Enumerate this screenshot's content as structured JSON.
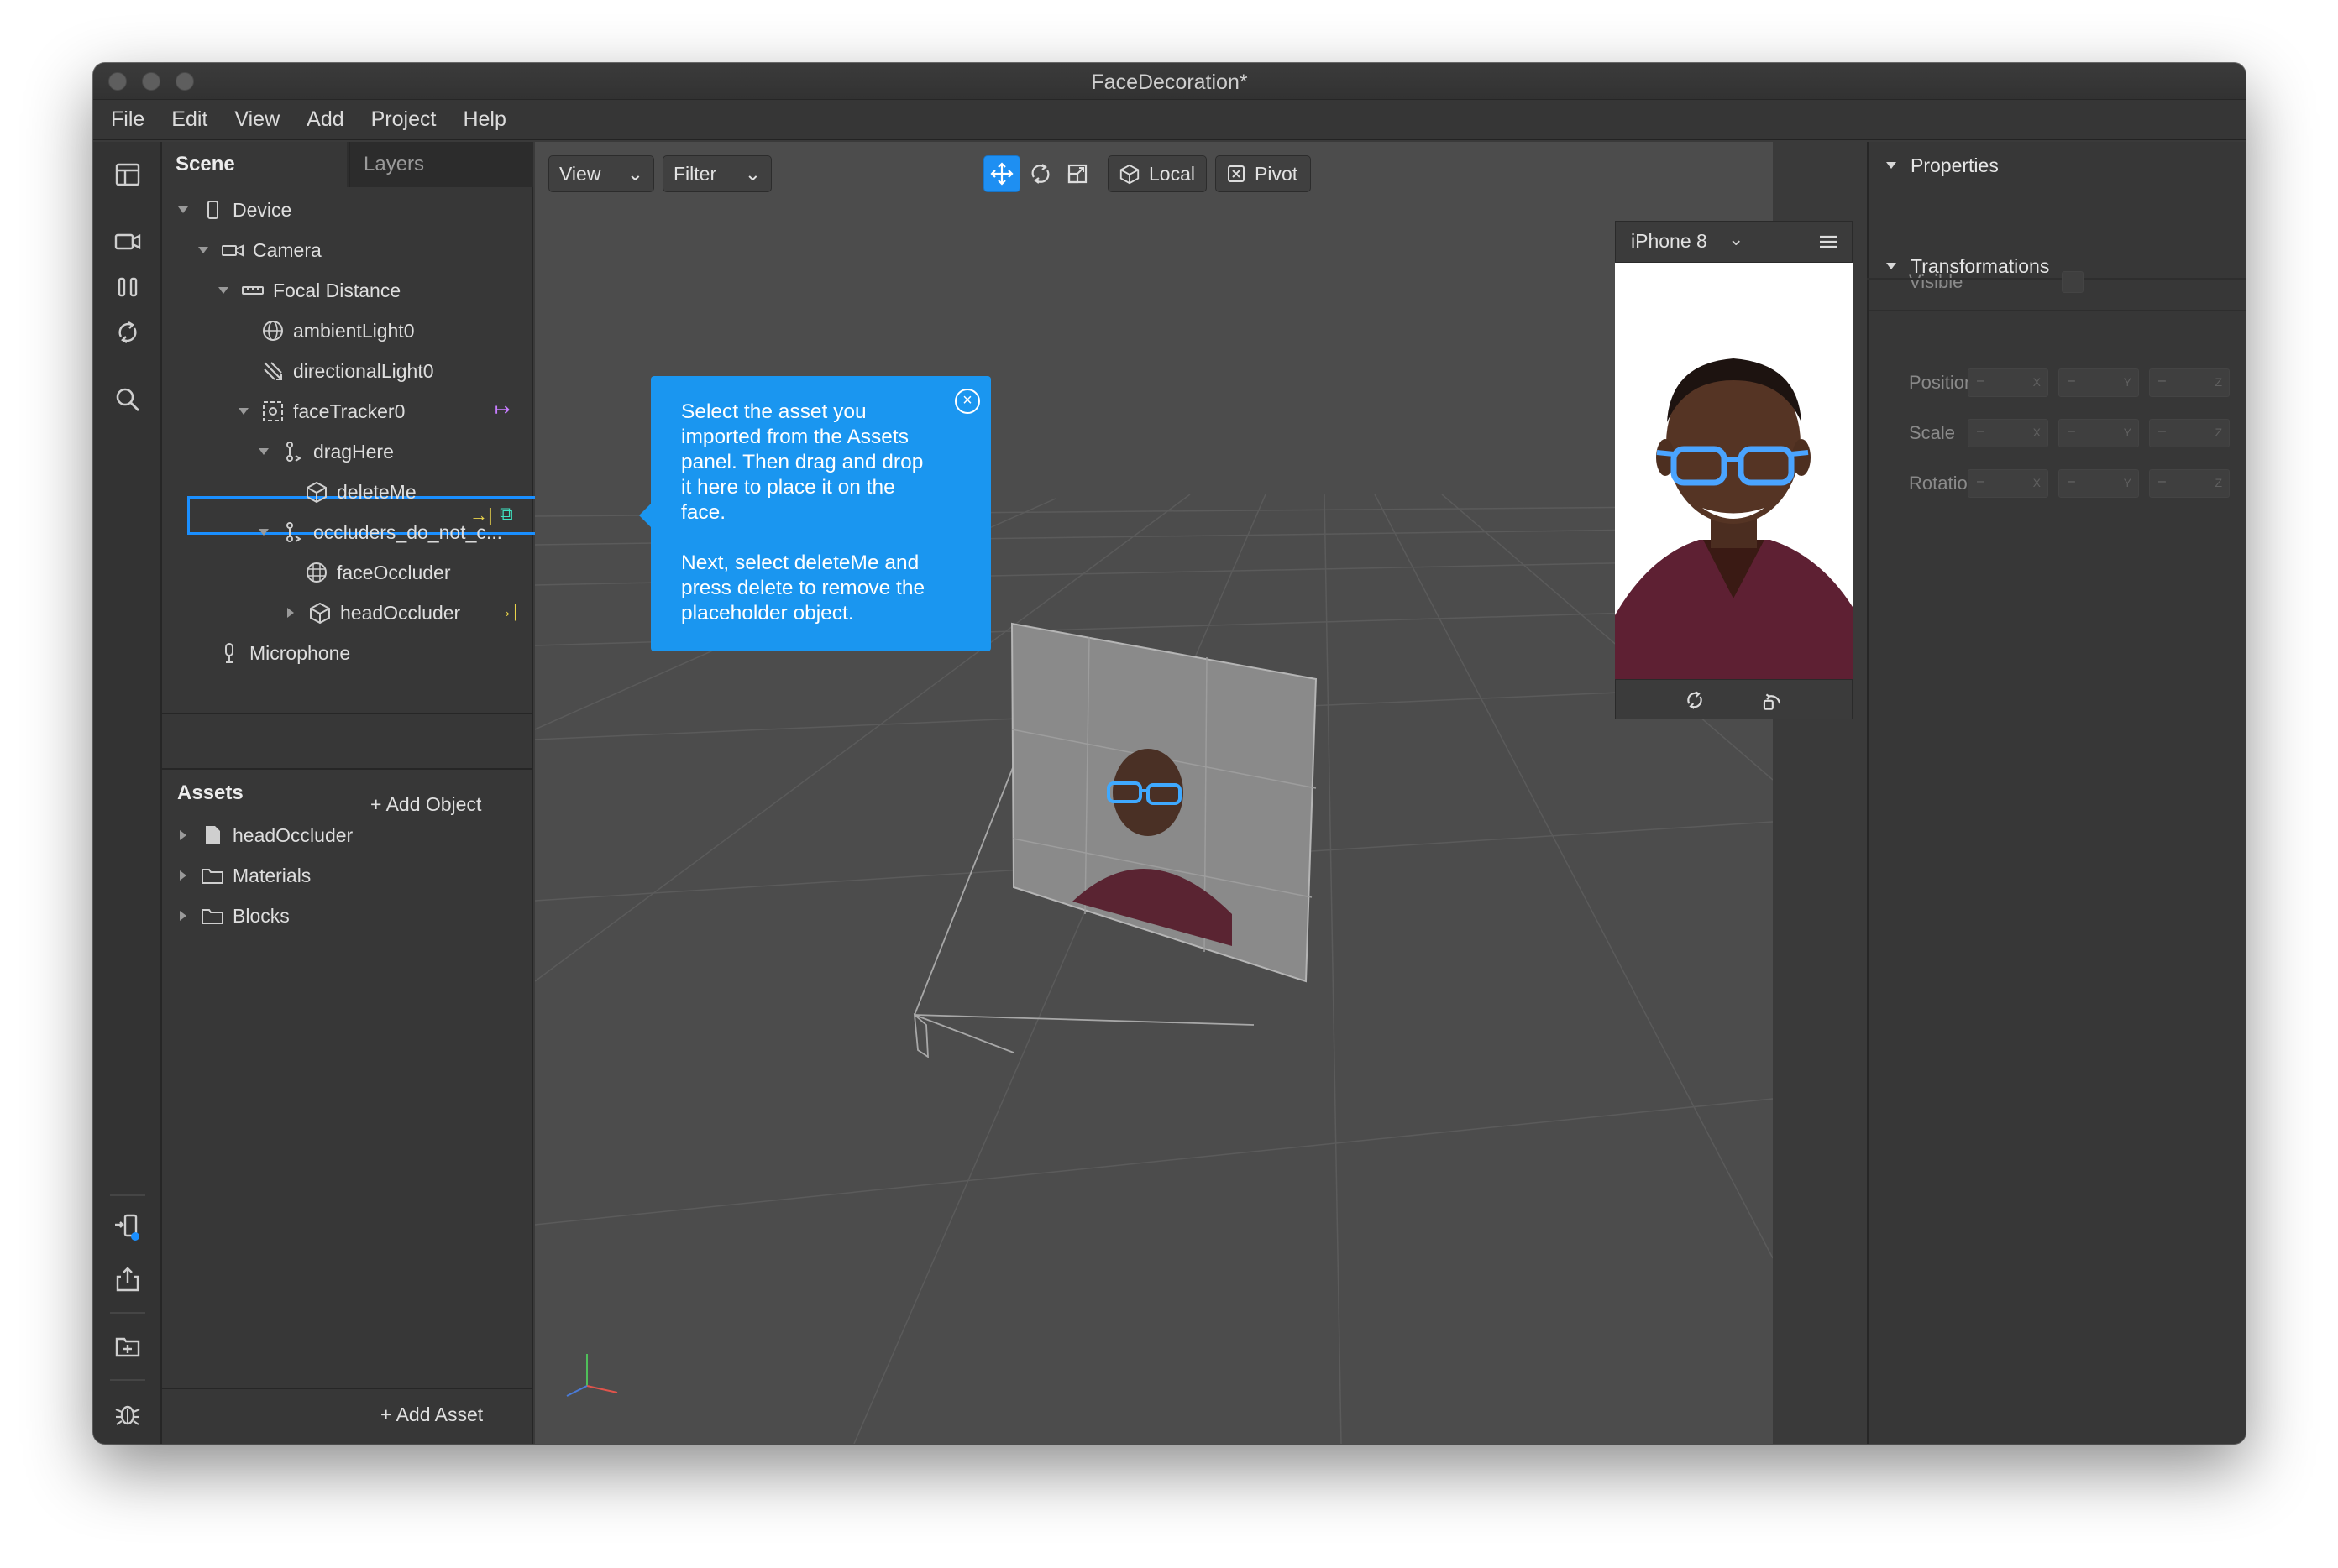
{
  "window": {
    "title": "FaceDecoration*"
  },
  "menu": [
    "File",
    "Edit",
    "View",
    "Add",
    "Project",
    "Help"
  ],
  "scene_panel": {
    "tabs": {
      "scene": "Scene",
      "layers": "Layers"
    },
    "tree": {
      "device": "Device",
      "camera": "Camera",
      "focal_distance": "Focal Distance",
      "ambient_light": "ambientLight0",
      "directional_light": "directionalLight0",
      "face_tracker": "faceTracker0",
      "drag_here": "dragHere",
      "delete_me": "deleteMe",
      "occluders": "occluders_do_not_c...",
      "face_occluder": "faceOccluder",
      "head_occluder": "headOccluder",
      "microphone": "Microphone"
    },
    "add_object": "Add Object"
  },
  "assets_panel": {
    "title": "Assets",
    "items": {
      "head_occluder": "headOccluder",
      "materials": "Materials",
      "blocks": "Blocks"
    },
    "add_asset": "Add Asset"
  },
  "viewport_toolbar": {
    "view": "View",
    "filter": "Filter",
    "local": "Local",
    "pivot": "Pivot"
  },
  "tooltip": {
    "line1": "Select the asset you",
    "line2": "imported from the Assets",
    "line3": "panel. Then drag and drop",
    "line4": "it here to place it on the",
    "line5": "face.",
    "line6": "Next, select deleteMe and",
    "line7": "press delete to remove the",
    "line8": "placeholder object."
  },
  "preview": {
    "device": "iPhone 8"
  },
  "properties": {
    "section1": "Properties",
    "visible": "Visible",
    "section2": "Transformations",
    "position": "Position",
    "scale": "Scale",
    "rotation": "Rotation",
    "axes": [
      "X",
      "Y",
      "Z"
    ],
    "empty_value": "–"
  },
  "colors": {
    "accent": "#1a96f0",
    "selection": "#1a8fff",
    "panel": "#373737",
    "viewport": "#4c4c4c"
  }
}
